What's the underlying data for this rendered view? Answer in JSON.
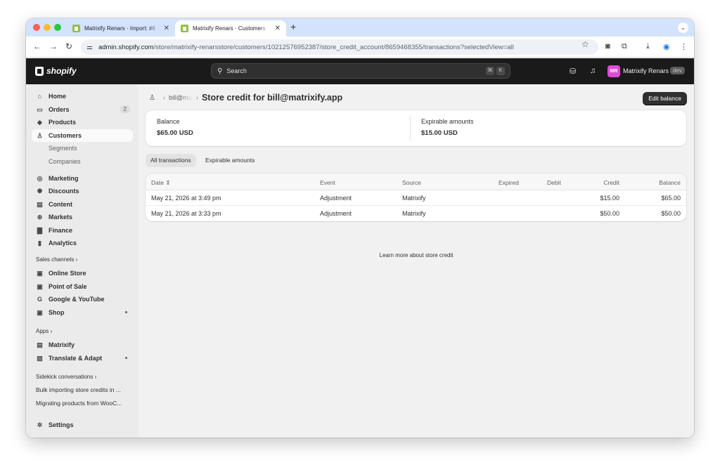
{
  "browser": {
    "tabs": [
      {
        "title": "Matrixify Renars · Import: #6",
        "active": false
      },
      {
        "title": "Matrixify Renars · Customers",
        "active": true
      }
    ],
    "url_host": "admin.shopify.com",
    "url_path": "/store/matrixify-renarsstore/customers/10212576952387/store_credit_account/8659468355/transactions?selectedView=all"
  },
  "topbar": {
    "logo": "shopify",
    "search_placeholder": "Search",
    "shortcut_key1": "⌘",
    "shortcut_key2": "K",
    "avatar_initials": "MR",
    "store_name": "Matrixify Renars",
    "dev_badge": "dev"
  },
  "sidebar": {
    "items": [
      {
        "label": "Home",
        "icon": "home-icon"
      },
      {
        "label": "Orders",
        "icon": "orders-icon",
        "badge": "2"
      },
      {
        "label": "Products",
        "icon": "tag-icon"
      },
      {
        "label": "Customers",
        "icon": "person-icon",
        "selected": true
      },
      {
        "label": "Segments",
        "sub": true
      },
      {
        "label": "Companies",
        "sub": true
      },
      {
        "label": "Marketing",
        "icon": "target-icon"
      },
      {
        "label": "Discounts",
        "icon": "discount-icon"
      },
      {
        "label": "Content",
        "icon": "content-icon"
      },
      {
        "label": "Markets",
        "icon": "globe-icon"
      },
      {
        "label": "Finance",
        "icon": "bank-icon"
      },
      {
        "label": "Analytics",
        "icon": "chart-icon"
      }
    ],
    "sales_channels_label": "Sales channels",
    "sales_channels": [
      {
        "label": "Online Store",
        "icon": "store-icon"
      },
      {
        "label": "Point of Sale",
        "icon": "pos-icon"
      },
      {
        "label": "Google & YouTube",
        "icon": "google-icon"
      },
      {
        "label": "Shop",
        "icon": "shop-icon"
      }
    ],
    "apps_label": "Apps",
    "apps": [
      {
        "label": "Matrixify",
        "icon": "app-icon"
      },
      {
        "label": "Translate & Adapt",
        "icon": "translate-icon"
      }
    ],
    "sidekick_label": "Sidekick conversations",
    "sidekick": [
      "Bulk importing store credits in ...",
      "Migrating products from WooC..."
    ],
    "settings_label": "Settings"
  },
  "page": {
    "breadcrumb_parent": "bill@matrixify.app",
    "title": "Store credit for bill@matrixify.app",
    "edit_button": "Edit balance",
    "balance_label": "Balance",
    "balance_value": "$65.00 USD",
    "expirable_label": "Expirable amounts",
    "expirable_value": "$15.00 USD",
    "tabs": [
      "All transactions",
      "Expirable amounts"
    ],
    "columns": [
      "Date",
      "Event",
      "Source",
      "Expired",
      "Debit",
      "Credit",
      "Balance"
    ],
    "rows": [
      {
        "date": "May 21, 2026 at 3:49 pm",
        "event": "Adjustment",
        "source": "Matrixify",
        "expired": "",
        "debit": "",
        "credit": "$15.00",
        "balance": "$65.00"
      },
      {
        "date": "May 21, 2026 at 3:33 pm",
        "event": "Adjustment",
        "source": "Matrixify",
        "expired": "",
        "debit": "",
        "credit": "$50.00",
        "balance": "$50.00"
      }
    ],
    "learn_more": "Learn more about store credit"
  }
}
